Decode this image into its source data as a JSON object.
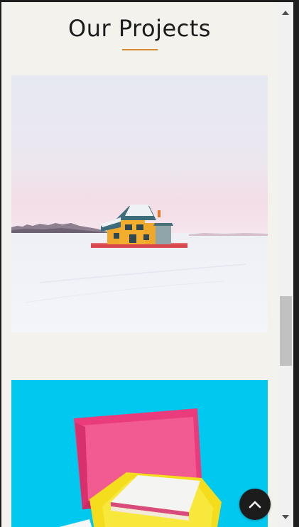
{
  "section": {
    "title": "Our Projects"
  },
  "projects": [
    {
      "image": "snowy-lake-house-photo"
    },
    {
      "image": "pink-yellow-boxes-photo"
    }
  ],
  "controls": {
    "back_to_top_icon": "chevron-up-icon",
    "scroll_up_icon": "triangle-up-icon",
    "scroll_down_icon": "triangle-down-icon"
  },
  "colors": {
    "background": "#f3f2ed",
    "accent_underline": "#d58a2e",
    "title": "#1b1b1b",
    "back_to_top_bg": "#1c1c1c"
  }
}
